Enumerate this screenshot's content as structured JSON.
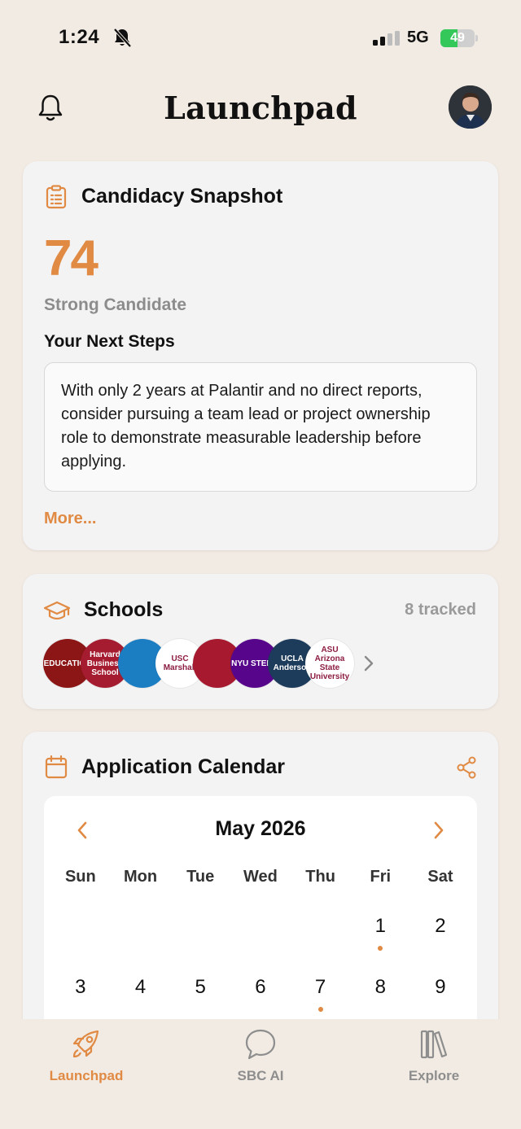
{
  "status_bar": {
    "time": "1:24",
    "network": "5G",
    "battery": "49",
    "battery_level": 0.49
  },
  "header": {
    "title": "Launchpad"
  },
  "snapshot": {
    "title": "Candidacy Snapshot",
    "score": "74",
    "score_label": "Strong Candidate",
    "next_steps_title": "Your Next Steps",
    "advice": "With only 2 years at Palantir and no direct reports, consider pursuing a team lead or project ownership role to demonstrate measurable leadership before applying.",
    "more_label": "More..."
  },
  "schools": {
    "title": "Schools",
    "count_label": "8 tracked",
    "logos": [
      {
        "text": "EDUCATION",
        "color": "#8c1515"
      },
      {
        "text": "Harvard Business School",
        "color": "#a51c30"
      },
      {
        "text": "",
        "color": "#1c7ec2"
      },
      {
        "text": "USC Marshall",
        "color": "#ffffff"
      },
      {
        "text": "",
        "color": "#a6192e"
      },
      {
        "text": "NYU STERN",
        "color": "#57068c"
      },
      {
        "text": "UCLA Anderson",
        "color": "#1d3b5b"
      },
      {
        "text": "ASU Arizona State University",
        "color": "#ffffff"
      }
    ]
  },
  "calendar": {
    "title": "Application Calendar",
    "month": "May 2026",
    "weekdays": [
      "Sun",
      "Mon",
      "Tue",
      "Wed",
      "Thu",
      "Fri",
      "Sat"
    ],
    "weeks": [
      [
        {
          "day": "",
          "event": false
        },
        {
          "day": "",
          "event": false
        },
        {
          "day": "",
          "event": false
        },
        {
          "day": "",
          "event": false
        },
        {
          "day": "",
          "event": false
        },
        {
          "day": "1",
          "event": true
        },
        {
          "day": "2",
          "event": false
        }
      ],
      [
        {
          "day": "3",
          "event": false
        },
        {
          "day": "4",
          "event": false
        },
        {
          "day": "5",
          "event": false
        },
        {
          "day": "6",
          "event": false
        },
        {
          "day": "7",
          "event": true
        },
        {
          "day": "8",
          "event": false
        },
        {
          "day": "9",
          "event": false
        }
      ]
    ]
  },
  "tabs": [
    {
      "label": "Launchpad",
      "active": true,
      "icon": "rocket-icon"
    },
    {
      "label": "SBC AI",
      "active": false,
      "icon": "chat-bubble-icon"
    },
    {
      "label": "Explore",
      "active": false,
      "icon": "library-icon"
    }
  ],
  "colors": {
    "accent": "#e08a44",
    "background": "#f2ebe3",
    "card": "#f3f3f3",
    "muted": "#9a9a9a"
  }
}
